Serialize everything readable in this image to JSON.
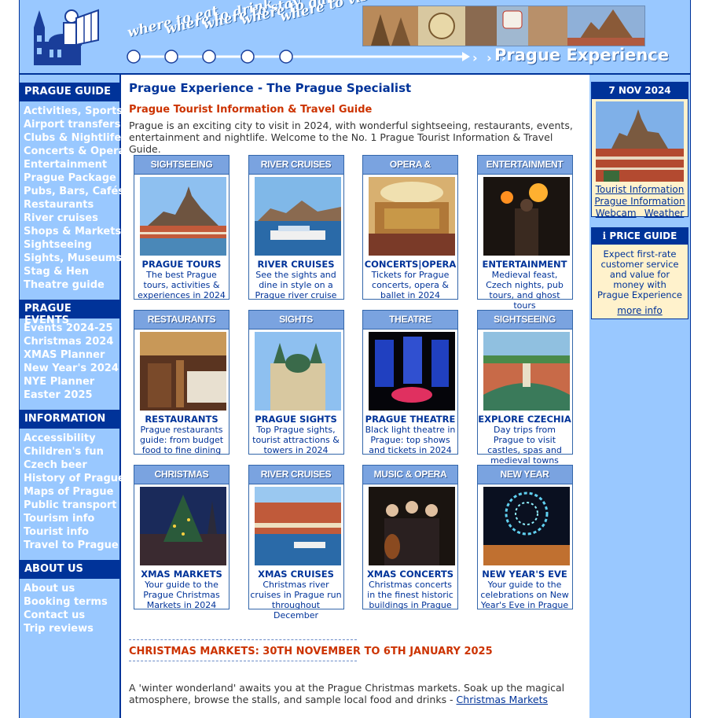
{
  "header": {
    "taglines": [
      "where to eat",
      "where to drink",
      "where to stay",
      "where to dance",
      "where to visit"
    ],
    "chevrons": "› › › ›",
    "brand": "Prague Experience"
  },
  "leftnav": {
    "sections": [
      {
        "title": "PRAGUE GUIDE",
        "items": [
          "Activities, Sports",
          "Airport transfers",
          "Clubs & Nightlife",
          "Concerts & Opera",
          "Entertainment",
          "Prague Package",
          "Pubs, Bars, Cafés",
          "Restaurants",
          "River cruises",
          "Shops & Markets",
          "Sightseeing",
          "Sights, Museums",
          "Stag & Hen",
          "Theatre guide"
        ]
      },
      {
        "title": "PRAGUE EVENTS",
        "items": [
          "Events 2024-25",
          "Christmas 2024",
          "XMAS Planner",
          "New Year's 2024",
          "NYE Planner",
          "Easter 2025"
        ]
      },
      {
        "title": "INFORMATION",
        "items": [
          "Accessibility",
          "Children's fun",
          "Czech beer",
          "History of Prague",
          "Maps of Prague",
          "Public transport",
          "Tourism info",
          "Tourist info",
          "Travel to Prague"
        ]
      },
      {
        "title": "ABOUT US",
        "items": [
          "About us",
          "Booking terms",
          "Contact us",
          "Trip reviews"
        ]
      }
    ]
  },
  "main": {
    "title": "Prague Experience - The Prague Specialist",
    "subtitle": "Prague Tourist Information & Travel Guide",
    "intro": "Prague is an exciting city to visit in 2024, with wonderful sightseeing, restaurants, events, entertainment and nightlife. Welcome to the No. 1 Prague Tourist Information & Travel Guide.",
    "cards": [
      {
        "header": "SIGHTSEEING",
        "title": "PRAGUE TOURS",
        "desc": "The best Prague tours, activities & experiences in 2024",
        "img": "castle"
      },
      {
        "header": "RIVER CRUISES",
        "title": "RIVER CRUISES",
        "desc": "See the sights and dine in style on a Prague river cruise",
        "img": "river"
      },
      {
        "header": "OPERA & CONCERTS",
        "title": "CONCERTS|OPERA",
        "desc": "Tickets for Prague concerts, opera & ballet in 2024",
        "img": "opera"
      },
      {
        "header": "ENTERTAINMENT",
        "title": "ENTERTAINMENT",
        "desc": "Medieval feast, Czech nights, pub tours, and ghost tours",
        "img": "fire"
      },
      {
        "header": "RESTAURANTS",
        "title": "RESTAURANTS",
        "desc": "Prague restaurants guide: from budget food to fine dining",
        "img": "restaurant"
      },
      {
        "header": "SIGHTS",
        "title": "PRAGUE SIGHTS",
        "desc": "Top Prague sights, tourist attractions & towers in 2024",
        "img": "church"
      },
      {
        "header": "THEATRE",
        "title": "PRAGUE THEATRE",
        "desc": "Black light theatre in Prague: top shows and tickets in 2024",
        "img": "theatre"
      },
      {
        "header": "SIGHTSEEING",
        "title": "EXPLORE CZECHIA",
        "desc": "Day trips from Prague to visit castles, spas and medieval towns",
        "img": "town"
      },
      {
        "header": "CHRISTMAS",
        "title": "XMAS MARKETS",
        "desc": "Your guide to the Prague Christmas Markets in 2024",
        "img": "xmas"
      },
      {
        "header": "RIVER CRUISES",
        "title": "XMAS CRUISES",
        "desc": "Christmas river cruises in Prague run throughout December",
        "img": "river2"
      },
      {
        "header": "MUSIC & OPERA",
        "title": "XMAS CONCERTS",
        "desc": "Christmas concerts in the finest historic buildings in Prague",
        "img": "music"
      },
      {
        "header": "NEW YEAR",
        "title": "NEW YEAR'S EVE",
        "desc": "Your guide to the celebrations on New Year's Eve in Prague",
        "img": "fireworks"
      }
    ],
    "xmas_heading": "CHRISTMAS MARKETS: 30TH NOVEMBER TO 6TH JANUARY 2025",
    "xmas_text": "A 'winter wonderland' awaits you at the Prague Christmas markets. Soak up the magical atmosphere, browse the stalls, and sample local food and drinks - ",
    "xmas_link": "Christmas Markets"
  },
  "right": {
    "date": "7 NOV 2024",
    "links": [
      "Tourist Information",
      "Prague Information",
      "Webcam",
      "Weather"
    ],
    "price_title": "PRICE GUIDE",
    "price_text": "Expect first-rate customer service and value for money with Prague Experience",
    "price_link": "more info"
  },
  "colors": {
    "navy": "#003399",
    "sky": "#99c8ff",
    "accent": "#cc3300",
    "cream": "#fff2cc"
  }
}
